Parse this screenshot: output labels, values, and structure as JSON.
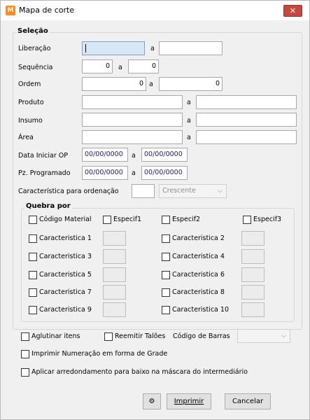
{
  "window": {
    "title": "Mapa de corte",
    "close_symbol": "✕",
    "app_icon_glyph": "M"
  },
  "selection": {
    "legend": "Seleção",
    "liberacao": {
      "label": "Liberação",
      "sep": "a",
      "from": "",
      "to": ""
    },
    "sequencia": {
      "label": "Sequência",
      "sep": "a",
      "from": "0",
      "to": "0"
    },
    "ordem": {
      "label": "Ordem",
      "sep": "a",
      "from": "0",
      "to": "0"
    },
    "produto": {
      "label": "Produto",
      "sep": "a",
      "from": "",
      "to": ""
    },
    "insumo": {
      "label": "Insumo",
      "sep": "a",
      "from": "",
      "to": ""
    },
    "area": {
      "label": "Área",
      "sep": "a",
      "from": "",
      "to": ""
    },
    "data_iniciar": {
      "label": "Data Iniciar OP",
      "sep": "a",
      "from": "00/00/0000",
      "to": "00/00/0000"
    },
    "pz_programado": {
      "label": "Pz. Programado",
      "sep": "a",
      "from": "00/00/0000",
      "to": "00/00/0000"
    },
    "caracteristica_ordenacao": {
      "label": "Característica para ordenação",
      "value": "",
      "order": "Crescente",
      "arrow": "⌵"
    }
  },
  "quebra": {
    "legend": "Quebra por",
    "codigo_material": "Código Material",
    "especif1": "Especif1",
    "especif2": "Especif2",
    "especif3": "Especif3",
    "c1": "Caracteristica 1",
    "c2": "Caracteristica 2",
    "c3": "Caracteristica 3",
    "c4": "Caracteristica 4",
    "c5": "Caracteristica 5",
    "c6": "Caracteristica 6",
    "c7": "Caracteristica 7",
    "c8": "Caracteristica 8",
    "c9": "Caracteristica 9",
    "c10": "Caracteristica 10"
  },
  "options": {
    "aglutinar": "Aglutinar itens",
    "reemitir": "Reemitir Talões",
    "codigo_barras_label": "Código de Barras",
    "codigo_barras_value": "",
    "codigo_barras_arrow": "⌵",
    "imprimir_grade": "Imprimir Numeração em forma de Grade",
    "arredondamento": "Aplicar arredondamento para baixo na máscara do intermediário"
  },
  "buttons": {
    "settings_glyph": "⚙",
    "imprimir": "Imprimir",
    "cancelar": "Cancelar"
  },
  "colors": {
    "title_bg": "#ffffff",
    "window_bg": "#f0f0f0",
    "close_bg": "#c8463c",
    "date_text": "#1a1a7e",
    "focus_bg": "#d6e8f3"
  }
}
